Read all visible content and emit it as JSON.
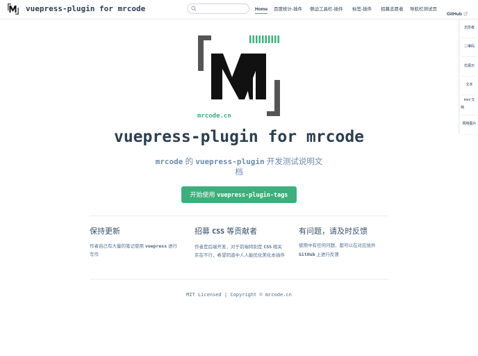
{
  "site": {
    "title": "vuepress-plugin for mrcode"
  },
  "search": {
    "placeholder": ""
  },
  "nav": {
    "items": [
      {
        "label": "Home",
        "active": true
      },
      {
        "label": "百度统计-插件"
      },
      {
        "label": "侧边工具栏-插件"
      },
      {
        "label": "标签-插件"
      },
      {
        "label": "招募志愿者"
      },
      {
        "label": "导航栏测试页"
      },
      {
        "label": "GitHub",
        "external": true
      }
    ]
  },
  "side_panel": {
    "items": [
      "志愿者",
      "二维码",
      "优展示",
      "文本",
      "html 文",
      "档",
      "网络图片"
    ]
  },
  "hero": {
    "image_caption": "mrcode.cn",
    "title": "vuepress-plugin for mrcode",
    "desc_code1": "mrcode",
    "desc_text1": "的",
    "desc_code2": "vuepress-plugin",
    "desc_text2": "开发测试说明文档",
    "action_text": "开始使用",
    "action_code": "vuepress-plugin-tags"
  },
  "features": [
    {
      "title": "保持更新",
      "text_before": "作者自己有大量的笔记使用",
      "code": "vuepress",
      "text_after": "进行写作"
    },
    {
      "title_before": "招募",
      "title_code": "CSS",
      "title_after": "等贡献者",
      "text_before": "作者是后端开发，对于前端特别是",
      "code": "CSS",
      "text_after": "相关实在不行，希望同道中人人能优化美化本插件"
    },
    {
      "title": "有问题，请及时反馈",
      "text_before": "使用中有任何问题，都可以在对应插件",
      "code": "GitHub",
      "text_after": "上进行反馈"
    }
  ],
  "footer": {
    "text": "MIT Licensed | Copyright © mrcode.cn"
  },
  "colors": {
    "accent": "#3eaf7c",
    "text": "#2c3e50",
    "muted": "#6a8bad"
  }
}
